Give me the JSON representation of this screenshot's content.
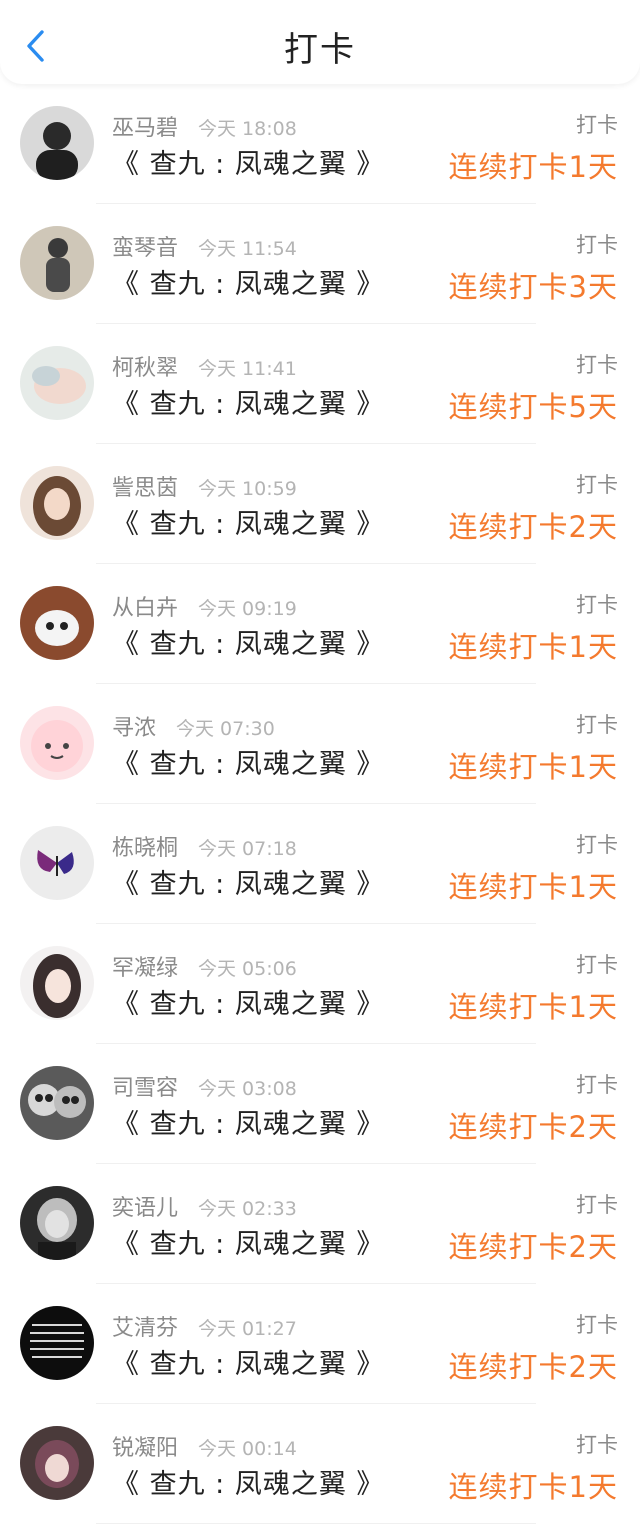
{
  "header": {
    "title": "打卡"
  },
  "colors": {
    "accent": "#f47a2e",
    "back_icon": "#2a8cf0",
    "muted": "#8a8a8a"
  },
  "rows": [
    {
      "name": "巫马碧",
      "time": "今天 18:08",
      "tag": "打卡",
      "book": "《 查九 : 凤魂之翼 》",
      "streak": "连续打卡1天"
    },
    {
      "name": "蛮琴音",
      "time": "今天 11:54",
      "tag": "打卡",
      "book": "《 查九 : 凤魂之翼 》",
      "streak": "连续打卡3天"
    },
    {
      "name": "柯秋翠",
      "time": "今天 11:41",
      "tag": "打卡",
      "book": "《 查九 : 凤魂之翼 》",
      "streak": "连续打卡5天"
    },
    {
      "name": "訾思茵",
      "time": "今天 10:59",
      "tag": "打卡",
      "book": "《 查九 : 凤魂之翼 》",
      "streak": "连续打卡2天"
    },
    {
      "name": "从白卉",
      "time": "今天 09:19",
      "tag": "打卡",
      "book": "《 查九 : 凤魂之翼 》",
      "streak": "连续打卡1天"
    },
    {
      "name": "寻浓",
      "time": "今天 07:30",
      "tag": "打卡",
      "book": "《 查九 : 凤魂之翼 》",
      "streak": "连续打卡1天"
    },
    {
      "name": "栋晓桐",
      "time": "今天 07:18",
      "tag": "打卡",
      "book": "《 查九 : 凤魂之翼 》",
      "streak": "连续打卡1天"
    },
    {
      "name": "罕凝绿",
      "time": "今天 05:06",
      "tag": "打卡",
      "book": "《 查九 : 凤魂之翼 》",
      "streak": "连续打卡1天"
    },
    {
      "name": "司雪容",
      "time": "今天 03:08",
      "tag": "打卡",
      "book": "《 查九 : 凤魂之翼 》",
      "streak": "连续打卡2天"
    },
    {
      "name": "奕语儿",
      "time": "今天 02:33",
      "tag": "打卡",
      "book": "《 查九 : 凤魂之翼 》",
      "streak": "连续打卡2天"
    },
    {
      "name": "艾清芬",
      "time": "今天 01:27",
      "tag": "打卡",
      "book": "《 查九 : 凤魂之翼 》",
      "streak": "连续打卡2天"
    },
    {
      "name": "锐凝阳",
      "time": "今天 00:14",
      "tag": "打卡",
      "book": "《 查九 : 凤魂之翼 》",
      "streak": "连续打卡1天"
    }
  ]
}
